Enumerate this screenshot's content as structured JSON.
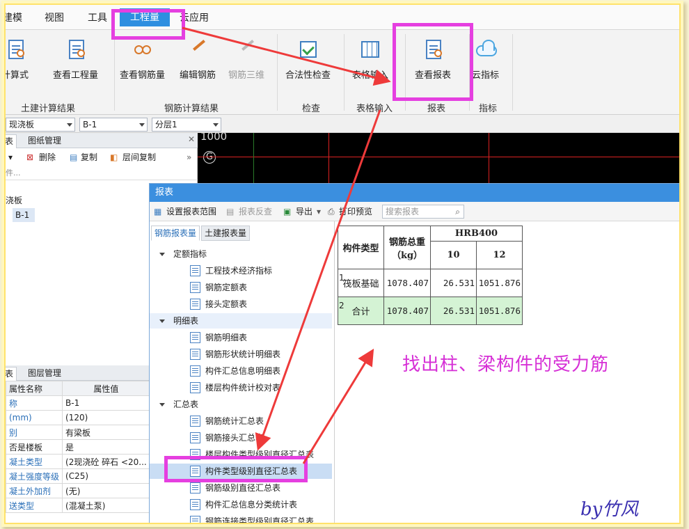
{
  "menu": {
    "items": [
      "建模",
      "视图",
      "工具",
      "工程量",
      "云应用"
    ],
    "active": "工程量"
  },
  "ribbon": {
    "groups": [
      {
        "label": "土建计算结果",
        "buttons": [
          "计算式",
          "查看工程量"
        ]
      },
      {
        "label": "钢筋计算结果",
        "buttons": [
          "查看钢筋量",
          "编辑钢筋",
          "钢筋三维"
        ]
      },
      {
        "label": "检查",
        "buttons": [
          "合法性检查"
        ]
      },
      {
        "label": "表格输入",
        "buttons": [
          "表格输入"
        ]
      },
      {
        "label": "报表",
        "buttons": [
          "查看报表"
        ]
      },
      {
        "label": "指标",
        "buttons": [
          "云指标"
        ]
      }
    ]
  },
  "selectors": {
    "type": "现浇板",
    "component": "B-1",
    "layer": "分层1"
  },
  "canvas": {
    "coord": "1000",
    "axis": "G"
  },
  "left_panel": {
    "tabs": [
      "表",
      "图纸管理"
    ],
    "toolbar": [
      "删除",
      "复制",
      "层间复制"
    ],
    "search_placeholder": "件...",
    "tree_root": "浇板",
    "tree_child": "B-1",
    "prop_tabs": [
      "表",
      "图层管理"
    ],
    "prop_headers": [
      "属性名称",
      "属性值"
    ],
    "props": [
      {
        "name": "称",
        "value": "B-1"
      },
      {
        "name": "(mm)",
        "value": "(120)"
      },
      {
        "name": "别",
        "value": "有梁板"
      },
      {
        "name": "否是楼板",
        "value": "是"
      },
      {
        "name": "凝土类型",
        "value": "(2现浇砼 碎石 <20..."
      },
      {
        "name": "凝土强度等级",
        "value": "(C25)"
      },
      {
        "name": "凝土外加剂",
        "value": "(无)"
      },
      {
        "name": "送类型",
        "value": "(混凝土泵)"
      }
    ]
  },
  "dialog": {
    "title": "报表",
    "toolbar": {
      "set_range": "设置报表范围",
      "reverse": "报表反查",
      "export": "导出",
      "print": "打印预览"
    },
    "search_placeholder": "搜索报表",
    "tabs": [
      "钢筋报表量",
      "土建报表量"
    ],
    "tree": [
      {
        "kind": "cat",
        "label": "定额指标"
      },
      {
        "kind": "leaf",
        "label": "工程技术经济指标"
      },
      {
        "kind": "leaf",
        "label": "钢筋定额表"
      },
      {
        "kind": "leaf",
        "label": "接头定额表"
      },
      {
        "kind": "cat",
        "label": "明细表"
      },
      {
        "kind": "leaf",
        "label": "钢筋明细表"
      },
      {
        "kind": "leaf",
        "label": "钢筋形状统计明细表"
      },
      {
        "kind": "leaf",
        "label": "构件汇总信息明细表"
      },
      {
        "kind": "leaf",
        "label": "楼层构件统计校对表"
      },
      {
        "kind": "cat",
        "label": "汇总表"
      },
      {
        "kind": "leaf",
        "label": "钢筋统计汇总表"
      },
      {
        "kind": "leaf",
        "label": "钢筋接头汇总表"
      },
      {
        "kind": "leaf",
        "label": "楼层构件类型级别直径汇总表"
      },
      {
        "kind": "leaf",
        "label": "构件类型级别直径汇总表"
      },
      {
        "kind": "leaf",
        "label": "钢筋级别直径汇总表"
      },
      {
        "kind": "leaf",
        "label": "构件汇总信息分类统计表"
      },
      {
        "kind": "leaf",
        "label": "钢筋连接类型级别直径汇总表"
      }
    ],
    "report": {
      "headers": {
        "type": "构件类型",
        "weight": "钢筋总重（kg）",
        "grade": "HRB400",
        "d1": "10",
        "d2": "12"
      },
      "rows": [
        {
          "idx": "1",
          "type": "筏板基础",
          "weight": "1078.407",
          "d1": "26.531",
          "d2": "1051.876"
        },
        {
          "idx": "2",
          "type": "合计",
          "weight": "1078.407",
          "d1": "26.531",
          "d2": "1051.876"
        }
      ]
    }
  },
  "annotation": "找出柱、梁构件的受力筋",
  "signature": "by竹风",
  "colors": {
    "highlight": "#e53fe0",
    "arrow": "#ee3a3a",
    "accent": "#2e8fe0",
    "total_row": "#d4f3d4",
    "annotation": "#d62fd6"
  }
}
